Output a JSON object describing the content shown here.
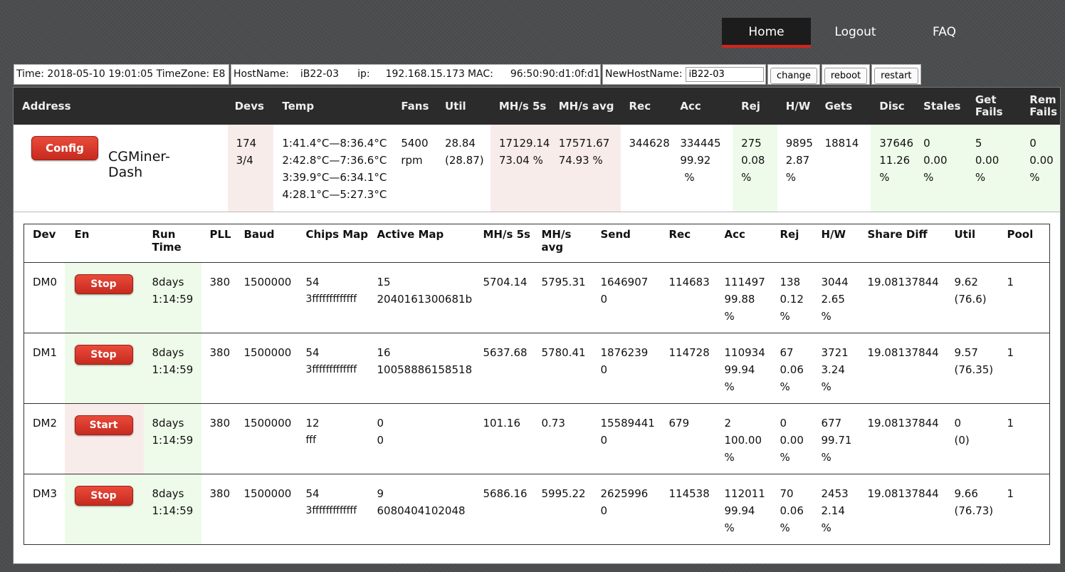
{
  "nav": {
    "items": [
      "Home",
      "Logout",
      "FAQ"
    ],
    "active": "Home"
  },
  "info": {
    "time": "Time: 2018-05-10 19:01:05 TimeZone: E8",
    "hostname_label": "HostName:",
    "hostname": "iB22-03",
    "ip_label": "ip:",
    "ip": "192.168.15.173",
    "mac_label": "MAC:",
    "mac": "96:50:90:d1:0f:d1",
    "newhost_label": "NewHostName:",
    "newhost_value": "iB22-03",
    "change_btn": "change",
    "reboot_btn": "reboot",
    "restart_btn": "restart"
  },
  "summary": {
    "headers": [
      "Address",
      "Devs",
      "Temp",
      "Fans",
      "Util",
      "MH/s 5s",
      "MH/s avg",
      "Rec",
      "Acc",
      "Rej",
      "H/W",
      "Gets",
      "Disc",
      "Stales",
      "Get Fails",
      "Rem Fails"
    ],
    "config_btn": "Config",
    "name": "CGMiner-Dash",
    "devs": [
      "174",
      "3/4"
    ],
    "temp": [
      "1:41.4°C—8:36.4°C",
      "2:42.8°C—7:36.6°C",
      "3:39.9°C—6:34.1°C",
      "4:28.1°C—5:27.3°C"
    ],
    "fans": [
      "5400",
      "rpm"
    ],
    "util": [
      "28.84",
      "(28.87)"
    ],
    "mhs5s": [
      "17129.14",
      "73.04 %"
    ],
    "mhsavg": [
      "17571.67",
      "74.93 %"
    ],
    "rec": [
      "344628"
    ],
    "acc": [
      "334445",
      "99.92",
      "%"
    ],
    "rej": [
      "275",
      "0.08",
      "%"
    ],
    "hw": [
      "9895",
      "2.87",
      "%"
    ],
    "gets": [
      "18814"
    ],
    "disc": [
      "37646",
      "11.26",
      "%"
    ],
    "stales": [
      "0",
      "0.00",
      "%"
    ],
    "getfails": [
      "5",
      "0.00",
      "%"
    ],
    "remfails": [
      "0",
      "0.00",
      "%"
    ]
  },
  "devices": {
    "headers": [
      "Dev",
      "En",
      "Run Time",
      "PLL",
      "Baud",
      "Chips Map",
      "Active Map",
      "MH/s 5s",
      "MH/s avg",
      "Send",
      "Rec",
      "Acc",
      "Rej",
      "H/W",
      "Share Diff",
      "Util",
      "Pool"
    ],
    "rows": [
      {
        "dev": "DM0",
        "btn": "Stop",
        "run": [
          "8days",
          "1:14:59"
        ],
        "pll": "380",
        "baud": "1500000",
        "chips": [
          "54",
          "3fffffffffffff"
        ],
        "active": [
          "15",
          "2040161300681b"
        ],
        "mhs5s": "5704.14",
        "mhsavg": "5795.31",
        "send": [
          "1646907",
          "0"
        ],
        "rec": "114683",
        "acc": [
          "111497",
          "99.88",
          "%"
        ],
        "rej": [
          "138",
          "0.12",
          "%"
        ],
        "hw": [
          "3044",
          "2.65",
          "%"
        ],
        "diff": "19.08137844",
        "util": [
          "9.62",
          "(76.6)"
        ],
        "pool": "1"
      },
      {
        "dev": "DM1",
        "btn": "Stop",
        "run": [
          "8days",
          "1:14:59"
        ],
        "pll": "380",
        "baud": "1500000",
        "chips": [
          "54",
          "3fffffffffffff"
        ],
        "active": [
          "16",
          "10058886158518"
        ],
        "mhs5s": "5637.68",
        "mhsavg": "5780.41",
        "send": [
          "1876239",
          "0"
        ],
        "rec": "114728",
        "acc": [
          "110934",
          "99.94",
          "%"
        ],
        "rej": [
          "67",
          "0.06",
          "%"
        ],
        "hw": [
          "3721",
          "3.24",
          "%"
        ],
        "diff": "19.08137844",
        "util": [
          "9.57",
          "(76.35)"
        ],
        "pool": "1"
      },
      {
        "dev": "DM2",
        "btn": "Start",
        "run": [
          "8days",
          "1:14:59"
        ],
        "pll": "380",
        "baud": "1500000",
        "chips": [
          "12",
          "fff"
        ],
        "active": [
          "0",
          "0"
        ],
        "mhs5s": "101.16",
        "mhsavg": "0.73",
        "send": [
          "15589441",
          "0"
        ],
        "rec": "679",
        "acc": [
          "2",
          "100.00",
          "%"
        ],
        "rej": [
          "0",
          "0.00",
          "%"
        ],
        "hw": [
          "677",
          "99.71",
          "%"
        ],
        "diff": "19.08137844",
        "util": [
          "0",
          "(0)"
        ],
        "pool": "1"
      },
      {
        "dev": "DM3",
        "btn": "Stop",
        "run": [
          "8days",
          "1:14:59"
        ],
        "pll": "380",
        "baud": "1500000",
        "chips": [
          "54",
          "3fffffffffffff"
        ],
        "active": [
          "9",
          "6080404102048"
        ],
        "mhs5s": "5686.16",
        "mhsavg": "5995.22",
        "send": [
          "2625996",
          "0"
        ],
        "rec": "114538",
        "acc": [
          "112011",
          "99.94",
          "%"
        ],
        "rej": [
          "70",
          "0.06",
          "%"
        ],
        "hw": [
          "2453",
          "2.14",
          "%"
        ],
        "diff": "19.08137844",
        "util": [
          "9.66",
          "(76.73)"
        ],
        "pool": "1"
      }
    ]
  },
  "colors": {
    "accent_red": "#d2261b",
    "ok_green": "#eefbea",
    "warn_pink": "#f8eceb",
    "header_dark": "#2b2b2b"
  }
}
